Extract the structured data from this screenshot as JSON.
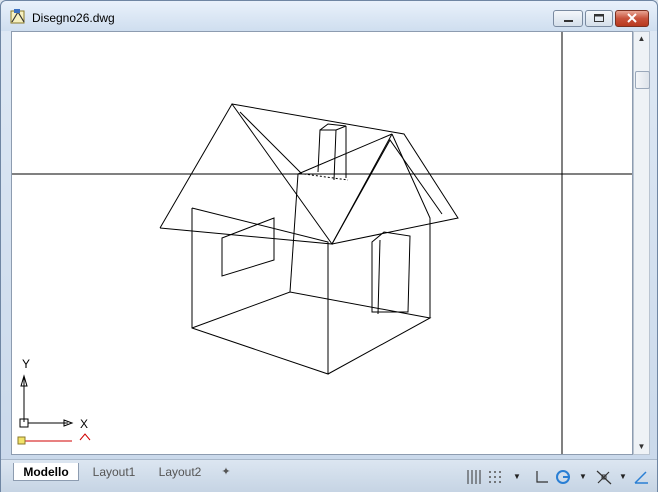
{
  "window": {
    "title": "Disegno26.dwg",
    "icons": [
      "autocad-drawing-icon",
      "minimize-icon",
      "maximize-icon",
      "close-icon"
    ]
  },
  "viewport": {
    "content": "house-wireframe-3d",
    "ucs_labels": {
      "y": "Y",
      "x": "X"
    }
  },
  "tabs": {
    "items": [
      {
        "label": "Modello",
        "active": true
      },
      {
        "label": "Layout1",
        "active": false
      },
      {
        "label": "Layout2",
        "active": false
      }
    ],
    "add_symbol": "✦"
  },
  "status_tools": [
    "grid-display-icon",
    "snap-mode-icon",
    "ortho-mode-icon",
    "polar-tracking-icon",
    "object-snap-icon",
    "dynamic-ucs-icon"
  ],
  "colors": {
    "titlebar": "#cfdeef",
    "close_button": "#c8523b",
    "canvas": "#ffffff",
    "crosshair": "#000000"
  }
}
